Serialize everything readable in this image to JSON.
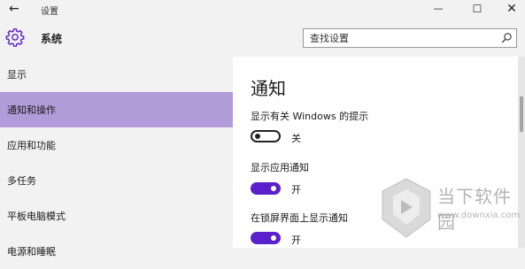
{
  "window": {
    "title": "设置",
    "back_glyph": "←",
    "minimize_glyph": "—",
    "maximize_glyph": "☐",
    "close_glyph": "✕"
  },
  "header": {
    "icon": "gear-icon",
    "title": "系统",
    "search_placeholder": "查找设置",
    "search_value": ""
  },
  "sidebar": {
    "items": [
      {
        "label": "显示",
        "active": false
      },
      {
        "label": "通知和操作",
        "active": true
      },
      {
        "label": "应用和功能",
        "active": false
      },
      {
        "label": "多任务",
        "active": false
      },
      {
        "label": "平板电脑模式",
        "active": false
      },
      {
        "label": "电源和睡眠",
        "active": false
      }
    ]
  },
  "main": {
    "section_title": "通知",
    "settings": [
      {
        "label": "显示有关 Windows 的提示",
        "on": false,
        "state_label": "关"
      },
      {
        "label": "显示应用通知",
        "on": true,
        "state_label": "开"
      },
      {
        "label": "在锁屏界面上显示通知",
        "on": true,
        "state_label": "开"
      }
    ]
  },
  "watermark": {
    "brand": "当下软件园",
    "url": "www.downxia.com"
  },
  "colors": {
    "accent": "#5a20cc",
    "sidebar_selected": "#b19cd9",
    "background": "#f2f2f2",
    "content_background": "#ffffff"
  }
}
